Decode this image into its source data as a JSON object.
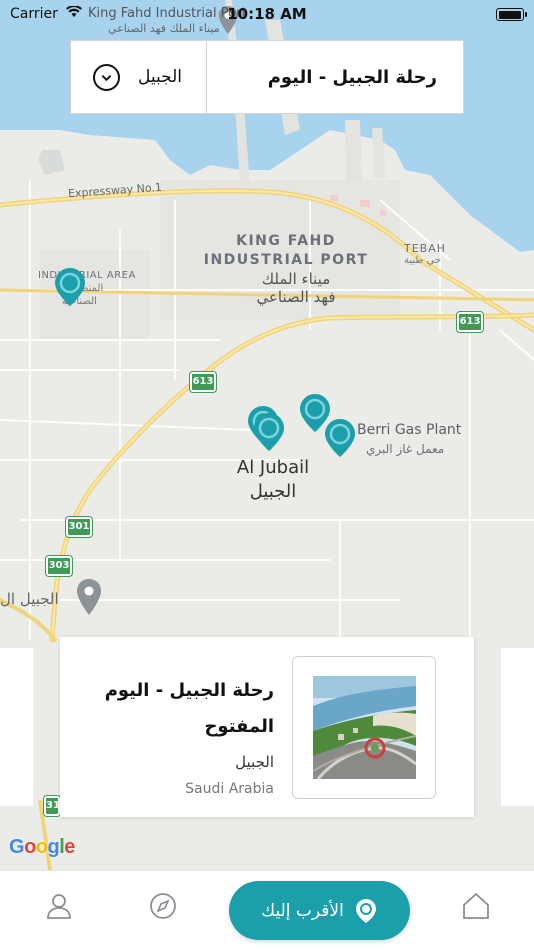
{
  "status_bar": {
    "carrier": "Carrier",
    "time": "10:18 AM",
    "battery_level": 1.0
  },
  "map": {
    "port_name_en": "King Fahd Industrial Port",
    "port_label_en_line1": "KING FAHD",
    "port_label_en_line2": "INDUSTRIAL PORT",
    "port_label_ar_line1": "ميناء الملك",
    "port_label_ar_line2": "فهد الصناعي",
    "port_name_ar_top": "ميناء الملك فهد الصناعي",
    "road_expressway": "Expressway No.1",
    "tebah_en": "TEBAH",
    "tebah_ar": "حي طبية",
    "industrial_area_en": "INDUSTRIAL AREA",
    "industrial_area_ar_1": "المنطقة",
    "industrial_area_ar_2": "الصناعية",
    "city_en": "Al Jubail",
    "city_ar": "الجبيل",
    "poi_en": "Berri Gas Plant",
    "poi_ar": "معمل غاز البري",
    "jubail_pin_ar": "الجبيل ال",
    "shields": [
      "613",
      "613",
      "301",
      "303",
      "31"
    ],
    "teal_color": "#1b9fab",
    "water_color": "#a8d3ee",
    "attribution": "Google"
  },
  "top_panel": {
    "city_select_value": "الجبيل",
    "trip_title": "رحلة الجبيل - اليوم"
  },
  "card": {
    "name": "رحلة الجبيل - اليوم المفتوح",
    "city": "الجبيل",
    "country": "Saudi Arabia"
  },
  "tab_bar": {
    "nearest_label": "الأقرب إليك",
    "items": [
      "profile-icon",
      "compass-icon",
      "location-pin-icon",
      "home-icon"
    ]
  }
}
